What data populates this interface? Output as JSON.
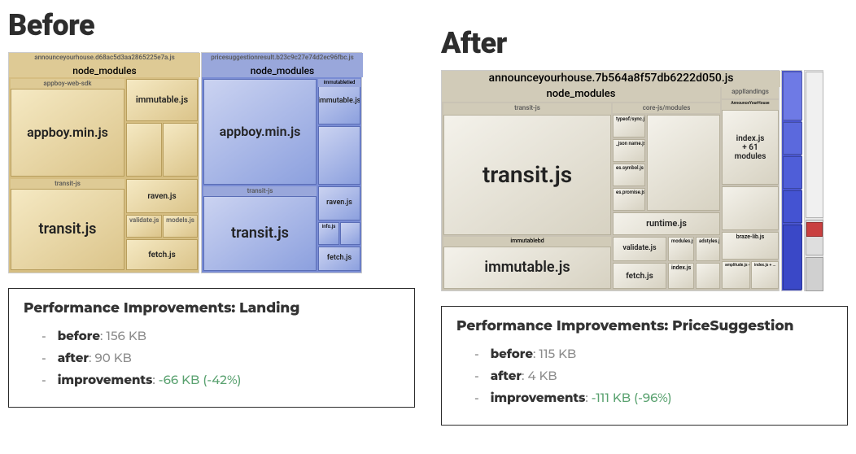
{
  "before": {
    "heading": "Before",
    "bundle_tan": {
      "file": "announceyourhouse.d68ac5d3aa2865225e7a.js",
      "root": "node_modules",
      "appboy_header": "appboy-web-sdk",
      "module_immutable": "immutable.js",
      "module_appboy": "appboy.min.js",
      "module_transit_inner": "transit-js",
      "module_transit": "transit.js",
      "module_raven": "raven.js",
      "module_fetch": "fetch.js",
      "module_validate": "validate.js",
      "module_models": "models.js"
    },
    "bundle_blue": {
      "file": "pricesuggestionresult.b23c9c27e74d2ec96fbc.js",
      "root": "node_modules",
      "module_immutable": "immutable.js",
      "immutabletied": "immutabletied",
      "module_appboy": "appboy.min.js",
      "module_transit_inner": "transit-js",
      "module_transit": "transit.js",
      "module_raven": "raven.js",
      "module_fetch": "fetch.js",
      "module_info": "info.js"
    }
  },
  "after": {
    "heading": "After",
    "bundle": {
      "file": "announceyourhouse.7b564a8f57db6222d050.js",
      "root": "node_modules",
      "transit_header": "transit-js",
      "module_transit": "transit.js",
      "immutablebd": "immutablebd",
      "module_immutable": "immutable.js",
      "corejs_header": "core-js/modules",
      "module_symbol": "es.symbol.js",
      "module_json": "_json name.js",
      "module_typeof": "typeof/sync.js",
      "module_promise": "es.promise.js",
      "module_runtime": "runtime.js",
      "module_validate": "validate.js",
      "module_adstyles": "adstyles.js",
      "module_modules": "modules.js",
      "module_index": "index.js",
      "module_fetch": "fetch.js",
      "applandings": "appllandings",
      "module_indexmodules": "index.js\n+ 61\nmodules",
      "announceY": "AnnounceYourHouse",
      "braze_lib": "braze-lib.js",
      "amplitude": "amplitude.js + 3 modules",
      "indexjs": "index.js + …"
    }
  },
  "stats_landing": {
    "title": "Performance Improvements: Landing",
    "before_label": "before",
    "before_val": ": 156 KB",
    "after_label": "after",
    "after_val": ": 90 KB",
    "improvements_label": "improvements",
    "improvements_sep": ": ",
    "improvements_val": "-66 KB (-42%)"
  },
  "stats_price": {
    "title": "Performance Improvements: PriceSuggestion",
    "before_label": "before",
    "before_val": ": 115 KB",
    "after_label": "after",
    "after_val": ": 4 KB",
    "improvements_label": "improvements",
    "improvements_sep": ": ",
    "improvements_val": "-111 KB (-96%)"
  }
}
